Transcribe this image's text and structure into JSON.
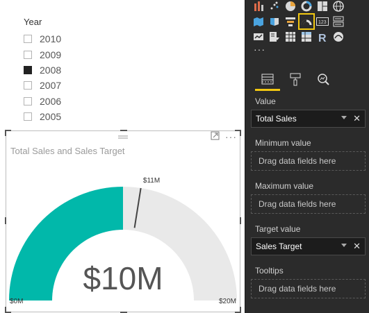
{
  "slicer": {
    "title": "Year",
    "items": [
      {
        "label": "2010",
        "checked": false
      },
      {
        "label": "2009",
        "checked": false
      },
      {
        "label": "2008",
        "checked": true
      },
      {
        "label": "2007",
        "checked": false
      },
      {
        "label": "2006",
        "checked": false
      },
      {
        "label": "2005",
        "checked": false
      }
    ]
  },
  "visual": {
    "title": "Total Sales and Sales Target",
    "focus_icon": "focus-mode-icon",
    "more_icon": "more-options-icon"
  },
  "chart_data": {
    "type": "gauge",
    "value": 10,
    "value_label": "$10M",
    "min": 0,
    "min_label": "$0M",
    "max": 20,
    "max_label": "$20M",
    "target": 11,
    "target_label": "$11M",
    "fill_color": "#01b8aa",
    "track_color": "#e9e9e9",
    "target_color": "#444444"
  },
  "viz_pane": {
    "rows": [
      [
        "ribbon-chart-icon",
        "scatter-chart-icon",
        "pie-chart-icon",
        "donut-chart-icon",
        "treemap-icon",
        "globe-map-icon"
      ],
      [
        "filled-map-icon",
        "shape-map-icon",
        "funnel-icon",
        "gauge-icon",
        "card-icon",
        "multirow-card-icon"
      ],
      [
        "kpi-icon",
        "slicer-icon",
        "table-icon",
        "matrix-icon",
        "r-visual-icon",
        "arcgis-icon"
      ]
    ],
    "selected": "gauge-icon",
    "more": "···"
  },
  "tabs": [
    "fields-tab-icon",
    "format-tab-icon",
    "analytics-tab-icon"
  ],
  "wells": [
    {
      "label": "Value",
      "field": "Total Sales"
    },
    {
      "label": "Minimum value",
      "placeholder": "Drag data fields here"
    },
    {
      "label": "Maximum value",
      "placeholder": "Drag data fields here"
    },
    {
      "label": "Target value",
      "field": "Sales Target"
    },
    {
      "label": "Tooltips",
      "placeholder": "Drag data fields here"
    }
  ],
  "colors": {
    "accent": "#f2c811",
    "pane_bg": "#2b2b2b"
  }
}
